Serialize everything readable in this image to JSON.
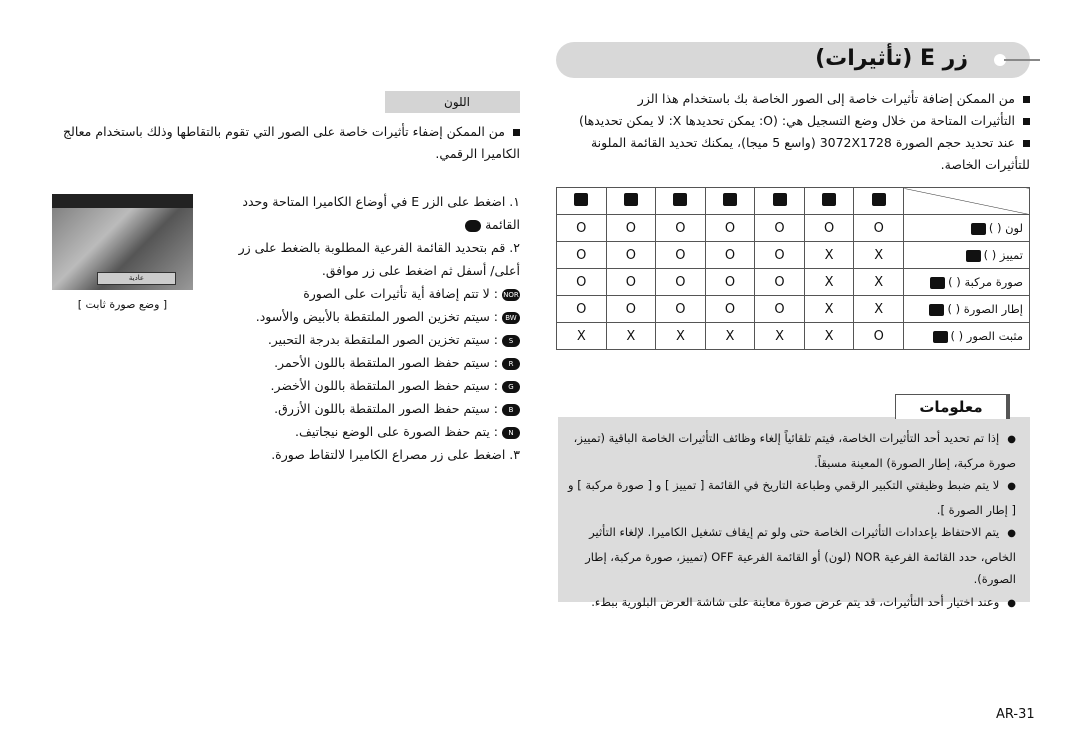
{
  "title": "زر E (تأثيرات)",
  "intro_bullets": [
    "من الممكن إضافة تأثيرات خاصة إلى الصور الخاصة بك باستخدام هذا الزر",
    "التأثيرات المتاحة من خلال وضع التسجيل هي: (O: يمكن تحديدها X: لا يمكن تحديدها)",
    "عند تحديد حجم الصورة 3072X1728 (واسع 5 ميجا)، يمكنك تحديد القائمة الملونة للتأثيرات الخاصة."
  ],
  "table": {
    "column_icons": [
      "macro-icon",
      "landscape-icon",
      "portrait-icon",
      "night-icon",
      "program-icon",
      "auto-icon",
      "movie-icon"
    ],
    "rows": [
      {
        "label": "لون (  )",
        "icon": "palette-icon",
        "values": [
          "O",
          "O",
          "O",
          "O",
          "O",
          "O",
          "O"
        ]
      },
      {
        "label": "تمييز (  )",
        "icon": "highlight-icon",
        "values": [
          "O",
          "O",
          "O",
          "O",
          "O",
          "X",
          "X"
        ]
      },
      {
        "label": "صورة مركبة (  )",
        "icon": "composite-icon",
        "values": [
          "O",
          "O",
          "O",
          "O",
          "O",
          "X",
          "X"
        ]
      },
      {
        "label": "إطار الصورة (  )",
        "icon": "photo-frame-icon",
        "values": [
          "O",
          "O",
          "O",
          "O",
          "O",
          "X",
          "X"
        ]
      },
      {
        "label": "مثبت الصور (  )",
        "icon": "stabilizer-icon",
        "values": [
          "X",
          "X",
          "X",
          "X",
          "X",
          "X",
          "O"
        ]
      }
    ]
  },
  "info": {
    "heading": "معلومات",
    "items": [
      "إذا تم تحديد أحد التأثيرات الخاصة، فيتم تلقائياً إلغاء وظائف التأثيرات الخاصة الباقية (تمييز، صورة مركبة، إطار الصورة) المعينة مسبقاً.",
      "لا يتم ضبط وظيفتي التكبير الرقمي وطباعة التاريخ في القائمة [ تمييز ] و [ صورة مركبة ] و [ إطار الصورة ].",
      "يتم الاحتفاظ بإعدادات التأثيرات الخاصة حتى ولو تم إيقاف تشغيل الكاميرا. لإلغاء التأثير الخاص، حدد القائمة الفرعية NOR (لون) أو القائمة الفرعية OFF (تمييز، صورة مركبة، إطار الصورة).",
      "وعند اختيار أحد التأثيرات، قد يتم عرض صورة معاينة على شاشة العرض البلورية ببطء."
    ]
  },
  "color_section": {
    "heading": "اللون",
    "bullet": "من الممكن إضفاء تأثيرات خاصة على الصور التي تقوم بالتقاطها وذلك باستخدام معالج الكاميرا الرقمي.",
    "photo_label": "عادية",
    "photo_caption": "[ وضع صورة ثابت ]",
    "step1": "١. اضغط على الزر E في أوضاع الكاميرا المتاحة وحدد القائمة",
    "step2": "٢. قم بتحديد القائمة الفرعية المطلوبة بالضغط على زر أعلى/ أسفل ثم اضغط على زر موافق.",
    "options": [
      {
        "icon": "NOR",
        "text": ": لا تتم إضافة أية تأثيرات على الصورة"
      },
      {
        "icon": "BW",
        "text": ": سيتم تخزين الصور الملتقطة بالأبيض والأسود."
      },
      {
        "icon": "S",
        "text": ": سيتم تخزين الصور الملتقطة بدرجة التحبير."
      },
      {
        "icon": "R",
        "text": ": سيتم حفظ الصور الملتقطة باللون الأحمر."
      },
      {
        "icon": "G",
        "text": ": سيتم حفظ الصور الملتقطة باللون الأخضر."
      },
      {
        "icon": "B",
        "text": ": سيتم حفظ الصور الملتقطة باللون الأزرق."
      },
      {
        "icon": "N",
        "text": ": يتم حفظ الصورة على الوضع نيجاتيف."
      }
    ],
    "step3": "٣. اضغط على زر مصراع الكاميرا لالتقاط صورة."
  },
  "page_number": "AR-31"
}
